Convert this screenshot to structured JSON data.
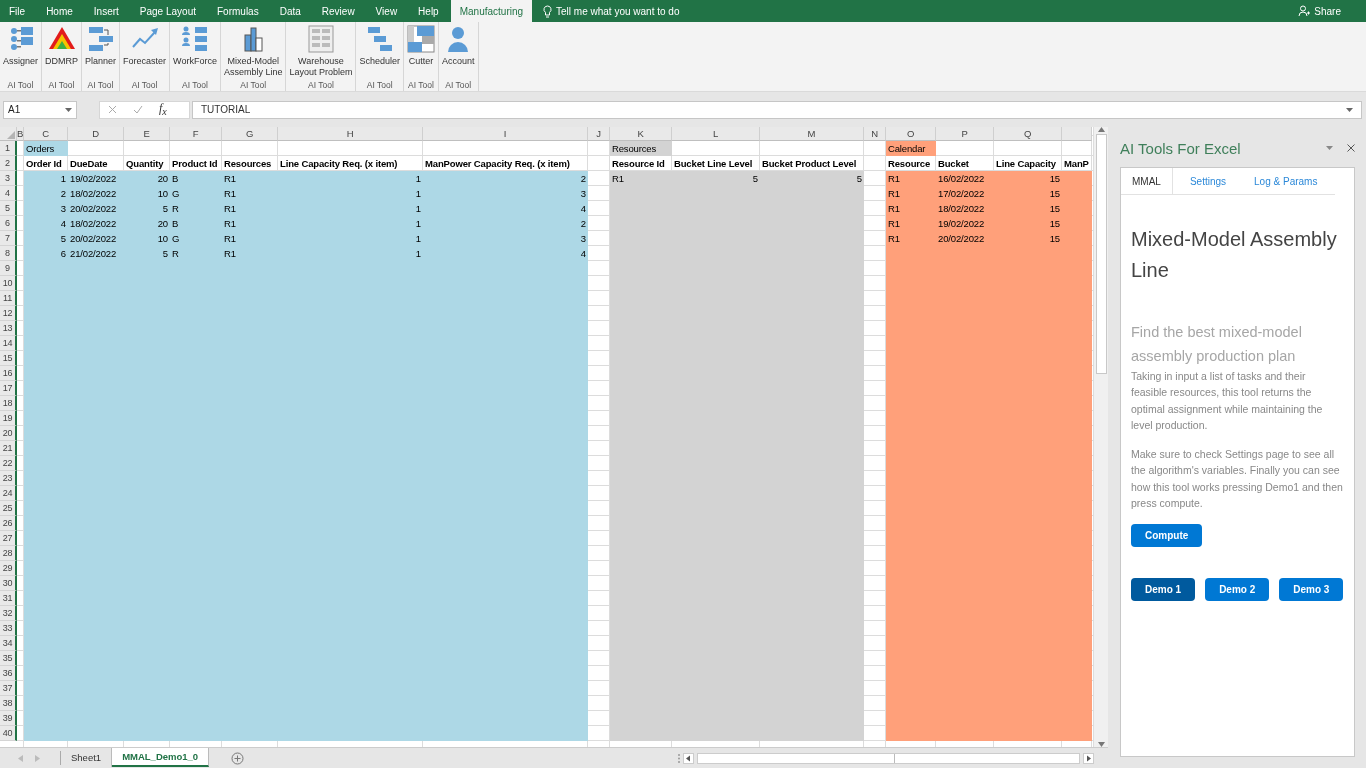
{
  "ribbon": {
    "tabs": [
      {
        "label": "File",
        "selected": false
      },
      {
        "label": "Home",
        "selected": false
      },
      {
        "label": "Insert",
        "selected": false
      },
      {
        "label": "Page Layout",
        "selected": false
      },
      {
        "label": "Formulas",
        "selected": false
      },
      {
        "label": "Data",
        "selected": false
      },
      {
        "label": "Review",
        "selected": false
      },
      {
        "label": "View",
        "selected": false
      },
      {
        "label": "Help",
        "selected": false
      },
      {
        "label": "Manufacturing",
        "selected": true
      }
    ],
    "tell_me": "Tell me what you want to do",
    "share": "Share",
    "groups": [
      {
        "buttons": [
          "Assigner"
        ],
        "label": "AI Tool"
      },
      {
        "buttons": [
          "DDMRP"
        ],
        "label": "AI Tool"
      },
      {
        "buttons": [
          "Planner"
        ],
        "label": "AI Tool"
      },
      {
        "buttons": [
          "Forecaster"
        ],
        "label": "AI Tool"
      },
      {
        "buttons": [
          "WorkForce"
        ],
        "label": "AI Tool"
      },
      {
        "buttons": [
          "Mixed-Model Assembly Line"
        ],
        "label": "AI Tool"
      },
      {
        "buttons": [
          "Warehouse Layout Problem"
        ],
        "label": "AI Tool"
      },
      {
        "buttons": [
          "Scheduler"
        ],
        "label": "AI Tool"
      },
      {
        "buttons": [
          "Cutter"
        ],
        "label": "AI Tool"
      },
      {
        "buttons": [
          "Account"
        ],
        "label": "AI Tool"
      }
    ]
  },
  "formula_bar": {
    "name_box": "A1",
    "function_label": "f$_{x}$",
    "value": "TUTORIAL"
  },
  "sheet": {
    "column_headers": [
      "B",
      "C",
      "D",
      "E",
      "F",
      "G",
      "H",
      "I",
      "J",
      "K",
      "L",
      "M",
      "N",
      "O",
      "P",
      "Q"
    ],
    "row_numbers": [
      "1",
      "2",
      "3",
      "4",
      "5",
      "6",
      "7",
      "8",
      "9",
      "10",
      "11",
      "12",
      "13",
      "14",
      "15",
      "16",
      "17",
      "18",
      "19",
      "20",
      "21",
      "22",
      "23",
      "24",
      "25",
      "26",
      "27",
      "28",
      "29",
      "30",
      "31",
      "32",
      "33",
      "34",
      "35",
      "36",
      "37",
      "38",
      "39",
      "40"
    ],
    "tables": [
      {
        "title": "Orders",
        "color": "#add8e6",
        "columns": [
          "Order Id",
          "DueDate",
          "Quantity",
          "Product Id",
          "Resources",
          "Line Capacity Req. (x item)",
          "ManPower Capacity Req. (x item)"
        ],
        "rows": [
          [
            "1",
            "19/02/2022",
            "20",
            "B",
            "R1",
            "1",
            "2"
          ],
          [
            "2",
            "18/02/2022",
            "10",
            "G",
            "R1",
            "1",
            "3"
          ],
          [
            "3",
            "20/02/2022",
            "5",
            "R",
            "R1",
            "1",
            "4"
          ],
          [
            "4",
            "18/02/2022",
            "20",
            "B",
            "R1",
            "1",
            "2"
          ],
          [
            "5",
            "20/02/2022",
            "10",
            "G",
            "R1",
            "1",
            "3"
          ],
          [
            "6",
            "21/02/2022",
            "5",
            "R",
            "R1",
            "1",
            "4"
          ]
        ]
      },
      {
        "title": "Resources",
        "color": "#d3d3d3",
        "columns": [
          "Resource Id",
          "Bucket Line Level",
          "Bucket Product Level"
        ],
        "rows": [
          [
            "R1",
            "5",
            "5"
          ]
        ]
      },
      {
        "title": "Calendar",
        "color": "#ffa07a",
        "columns": [
          "Resource",
          "Bucket",
          "Line Capacity",
          "ManP"
        ],
        "rows": [
          [
            "R1",
            "16/02/2022",
            "15"
          ],
          [
            "R1",
            "17/02/2022",
            "15"
          ],
          [
            "R1",
            "18/02/2022",
            "15"
          ],
          [
            "R1",
            "19/02/2022",
            "15"
          ],
          [
            "R1",
            "20/02/2022",
            "15"
          ]
        ]
      }
    ]
  },
  "sheet_tabs": [
    {
      "label": "Sheet1",
      "selected": false
    },
    {
      "label": "MMAL_Demo1_0",
      "selected": true
    }
  ],
  "task_pane": {
    "title": "AI Tools For Excel",
    "tabs": [
      {
        "label": "MMAL",
        "selected": true
      },
      {
        "label": "Settings",
        "selected": false
      },
      {
        "label": "Log & Params",
        "selected": false
      }
    ],
    "heading": "Mixed-Model Assembly Line",
    "subtitle": "Find the best mixed-model assembly production plan",
    "paragraphs": [
      "Taking in input a list of tasks and their feasible resources, this tool returns the optimal assignment while maintaining the level production.",
      "Make sure to check Settings page to see all the algorithm's variables. Finally you can see how this tool works pressing Demo1 and then press compute."
    ],
    "compute": "Compute",
    "demos": [
      {
        "label": "Demo 1",
        "selected": true
      },
      {
        "label": "Demo 2",
        "selected": false
      },
      {
        "label": "Demo 3",
        "selected": false
      }
    ]
  }
}
